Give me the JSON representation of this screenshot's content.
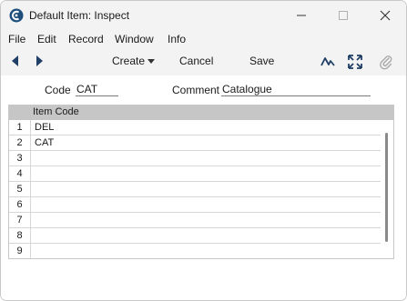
{
  "window": {
    "title": "Default Item: Inspect"
  },
  "menu": [
    "File",
    "Edit",
    "Record",
    "Window",
    "Info"
  ],
  "toolbar": {
    "create_label": "Create",
    "cancel_label": "Cancel",
    "save_label": "Save"
  },
  "form": {
    "code_label": "Code",
    "code_value": "CAT",
    "comment_label": "Comment",
    "comment_value": "Catalogue"
  },
  "table": {
    "header": "Item Code",
    "rows": [
      {
        "num": "1",
        "item_code": "DEL"
      },
      {
        "num": "2",
        "item_code": "CAT"
      },
      {
        "num": "3",
        "item_code": ""
      },
      {
        "num": "4",
        "item_code": ""
      },
      {
        "num": "5",
        "item_code": ""
      },
      {
        "num": "6",
        "item_code": ""
      },
      {
        "num": "7",
        "item_code": ""
      },
      {
        "num": "8",
        "item_code": ""
      },
      {
        "num": "9",
        "item_code": ""
      }
    ]
  },
  "icons": {
    "app": "app-logo-icon",
    "prev": "arrow-left-icon",
    "next": "arrow-right-icon",
    "create_dropdown": "caret-down-icon",
    "activity": "activity-icon",
    "expand": "expand-icon",
    "attach": "paperclip-icon"
  }
}
